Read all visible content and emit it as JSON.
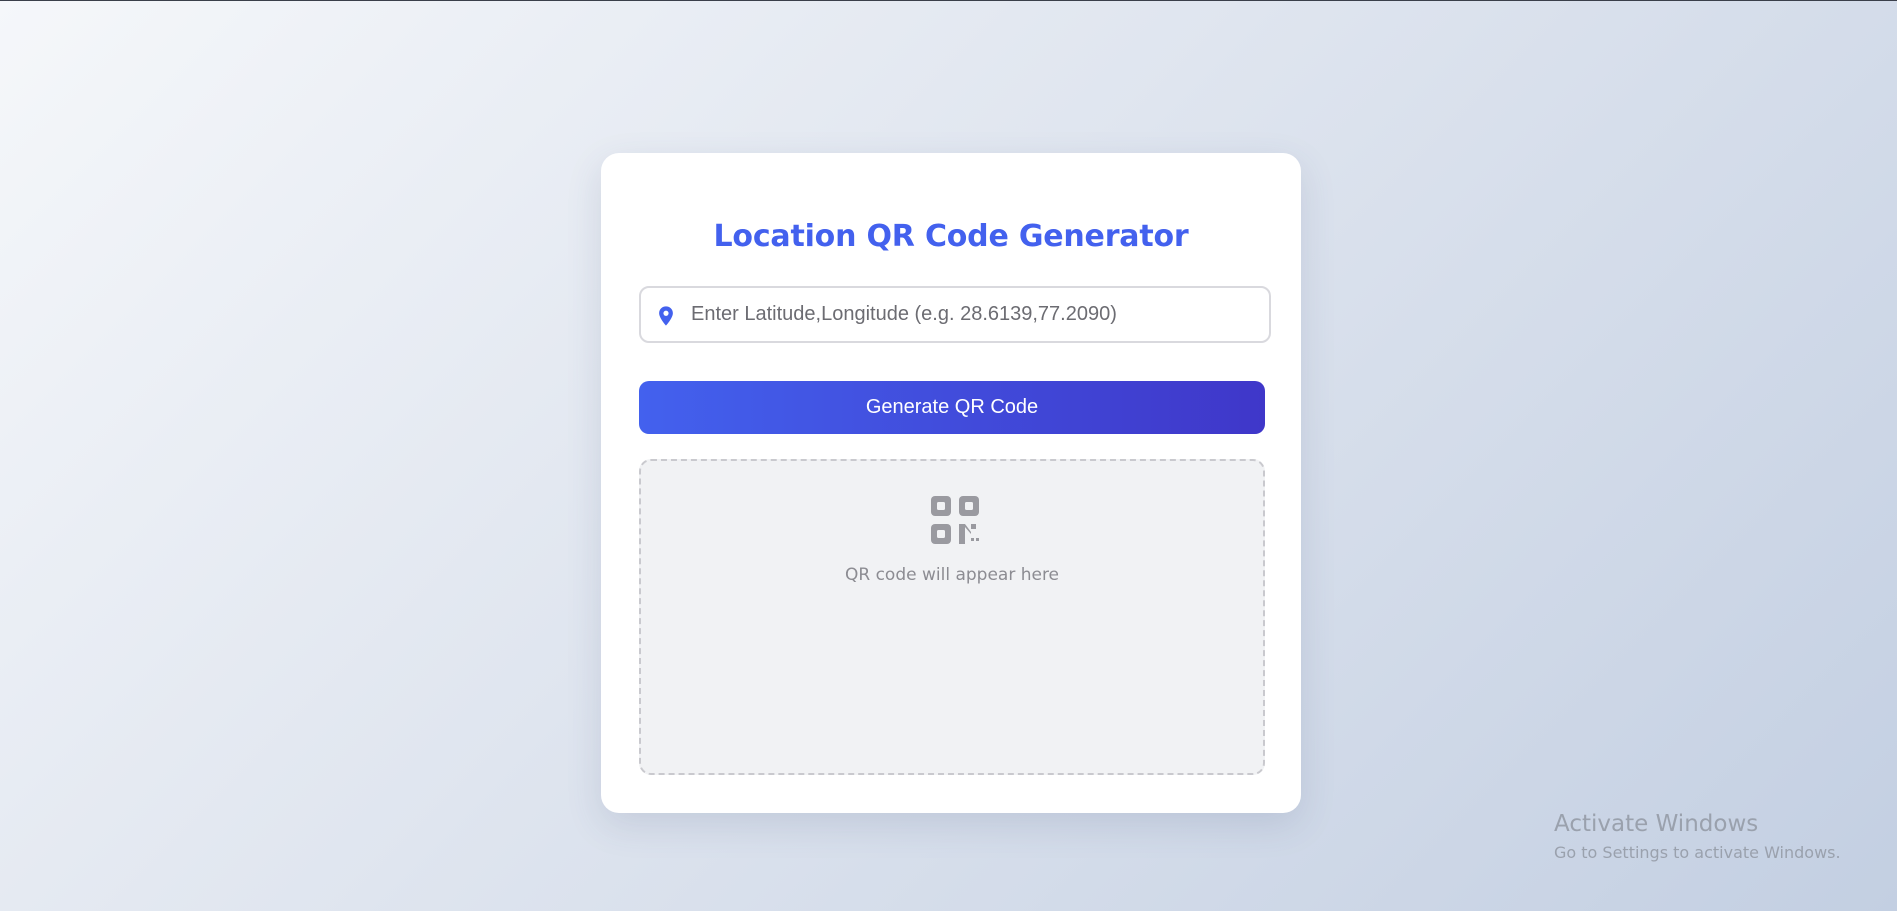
{
  "app": {
    "title": "Location QR Code Generator"
  },
  "location_input": {
    "icon": "map-pin-icon",
    "placeholder": "Enter Latitude,Longitude (e.g. 28.6139,77.2090)",
    "value": ""
  },
  "generate_button": {
    "label": "Generate QR Code"
  },
  "qr_output": {
    "icon": "qrcode-icon",
    "placeholder_text": "QR code will appear here"
  },
  "os_watermark": {
    "title": "Activate Windows",
    "subtitle": "Go to Settings to activate Windows."
  },
  "colors": {
    "accent": "#4361ee",
    "accent_dark": "#3f37c9",
    "placeholder_text": "#8c8c92"
  }
}
